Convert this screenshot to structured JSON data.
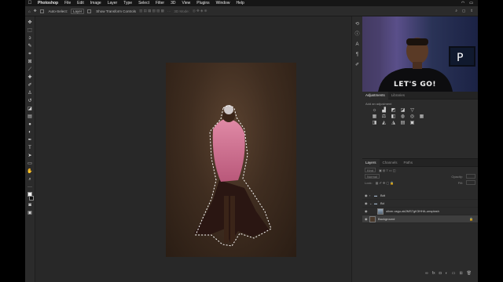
{
  "menubar": {
    "apple": "",
    "items": [
      "Photoshop",
      "File",
      "Edit",
      "Image",
      "Layer",
      "Type",
      "Select",
      "Filter",
      "3D",
      "View",
      "Plugins",
      "Window",
      "Help"
    ],
    "right_icons": [
      "wifi-icon",
      "battery-icon",
      "clock"
    ]
  },
  "options": {
    "auto_select_label": "Auto-Select:",
    "auto_select_value": "Layer",
    "transform_label": "Show Transform Controls",
    "mode_label": "3D Mode:"
  },
  "tools": {
    "icons": [
      "move-icon",
      "marquee-icon",
      "lasso-icon",
      "quick-select-icon",
      "crop-icon",
      "frame-icon",
      "eyedropper-icon",
      "healing-icon",
      "brush-icon",
      "stamp-icon",
      "history-brush-icon",
      "eraser-icon",
      "gradient-icon",
      "blur-icon",
      "dodge-icon",
      "pen-icon",
      "type-icon",
      "path-select-icon",
      "rectangle-icon",
      "hand-icon",
      "zoom-icon",
      "more-icon"
    ]
  },
  "adjustments": {
    "tabs": [
      "Adjustments",
      "Libraries"
    ],
    "hint": "Add an adjustment"
  },
  "layers": {
    "tabs": [
      "Layers",
      "Channels",
      "Paths"
    ],
    "kind_label": "Kind",
    "mode_label": "Normal",
    "opacity_label": "Opacity:",
    "lock_label": "Lock:",
    "fill_label": "Fill:",
    "items": [
      {
        "name": "Bdt",
        "type": "group"
      },
      {
        "name": "Bd",
        "type": "group"
      },
      {
        "name": "oliver-ragu-ak2MS7gK3HHA-unsplash",
        "type": "image"
      },
      {
        "name": "Background",
        "type": "background"
      }
    ]
  },
  "webcam": {
    "shirt_text": "LET'S GO!"
  },
  "colors": {
    "bg": "#282828",
    "panel": "#2b2b2b",
    "selection_ants": "#ffffff",
    "dress_pink": "#d77a98"
  }
}
